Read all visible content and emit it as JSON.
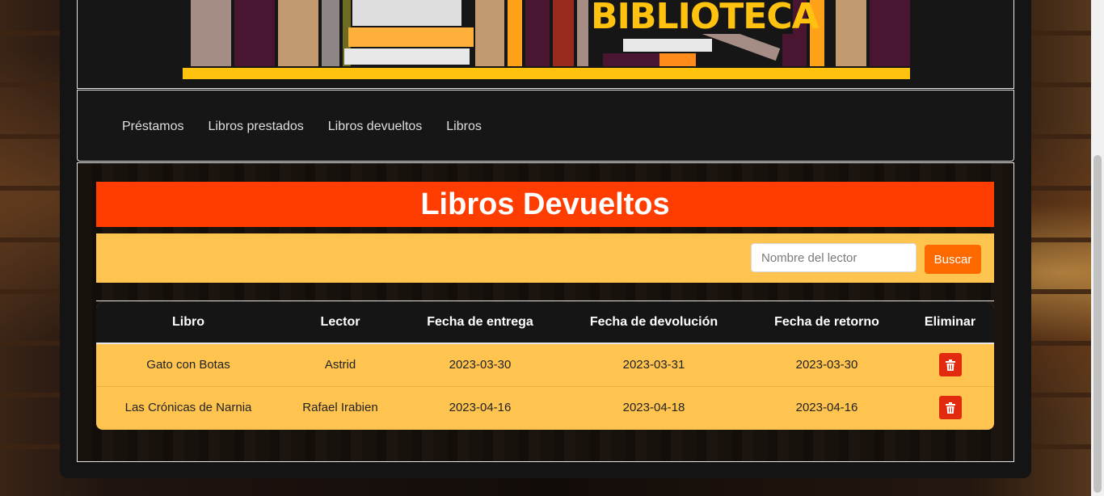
{
  "nav": {
    "items": [
      {
        "label": "Préstamos"
      },
      {
        "label": "Libros prestados"
      },
      {
        "label": "Libros devueltos"
      },
      {
        "label": "Libros"
      }
    ]
  },
  "banner": {
    "sign_text": "BIBLIOTECA"
  },
  "main": {
    "title": "Libros Devueltos",
    "search": {
      "placeholder": "Nombre del lector",
      "button_label": "Buscar"
    },
    "table": {
      "headers": [
        "Libro",
        "Lector",
        "Fecha de entrega",
        "Fecha de devolución",
        "Fecha de retorno",
        "Eliminar"
      ],
      "rows": [
        {
          "libro": "Gato con Botas",
          "lector": "Astrid",
          "entrega": "2023-03-30",
          "devolucion": "2023-03-31",
          "retorno": "2023-03-30"
        },
        {
          "libro": "Las Crónicas de Narnia",
          "lector": "Rafael Irabien",
          "entrega": "2023-04-16",
          "devolucion": "2023-04-18",
          "retorno": "2023-04-16"
        }
      ]
    }
  },
  "colors": {
    "title_bar": "#ff3d00",
    "search_bar": "#ffc44f",
    "search_button": "#ff6a00",
    "delete_button": "#e22a0c",
    "banner_accent": "#ffc20e"
  },
  "icons": {
    "delete": "trash-icon"
  }
}
